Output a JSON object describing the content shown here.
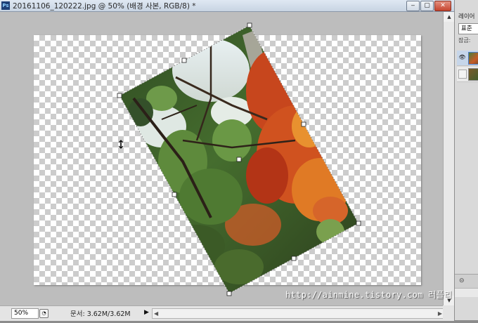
{
  "window": {
    "app_badge": "Ps",
    "title": "20161106_120222.jpg @ 50% (배경 사본, RGB/8) *",
    "min_glyph": "‒",
    "max_glyph": "▢",
    "close_glyph": "✕"
  },
  "status": {
    "zoom": "50%",
    "doc_info": "문서: 3.62M/3.62M",
    "menu_arrow": "▶"
  },
  "scrollbar": {
    "up": "▲",
    "down": "▼",
    "left": "◀",
    "right": "▶"
  },
  "watermark": "http://ainmine.tistory.com 러플리",
  "layers_panel": {
    "title": "레이어",
    "blend_mode": "표준",
    "lock_label": "잠금:",
    "eye_glyph": "👁",
    "footer_glyph": "⊝"
  },
  "colors": {
    "accent": "#4b79c2",
    "titlebar": "#c8d4e3",
    "close": "#c5452f"
  }
}
